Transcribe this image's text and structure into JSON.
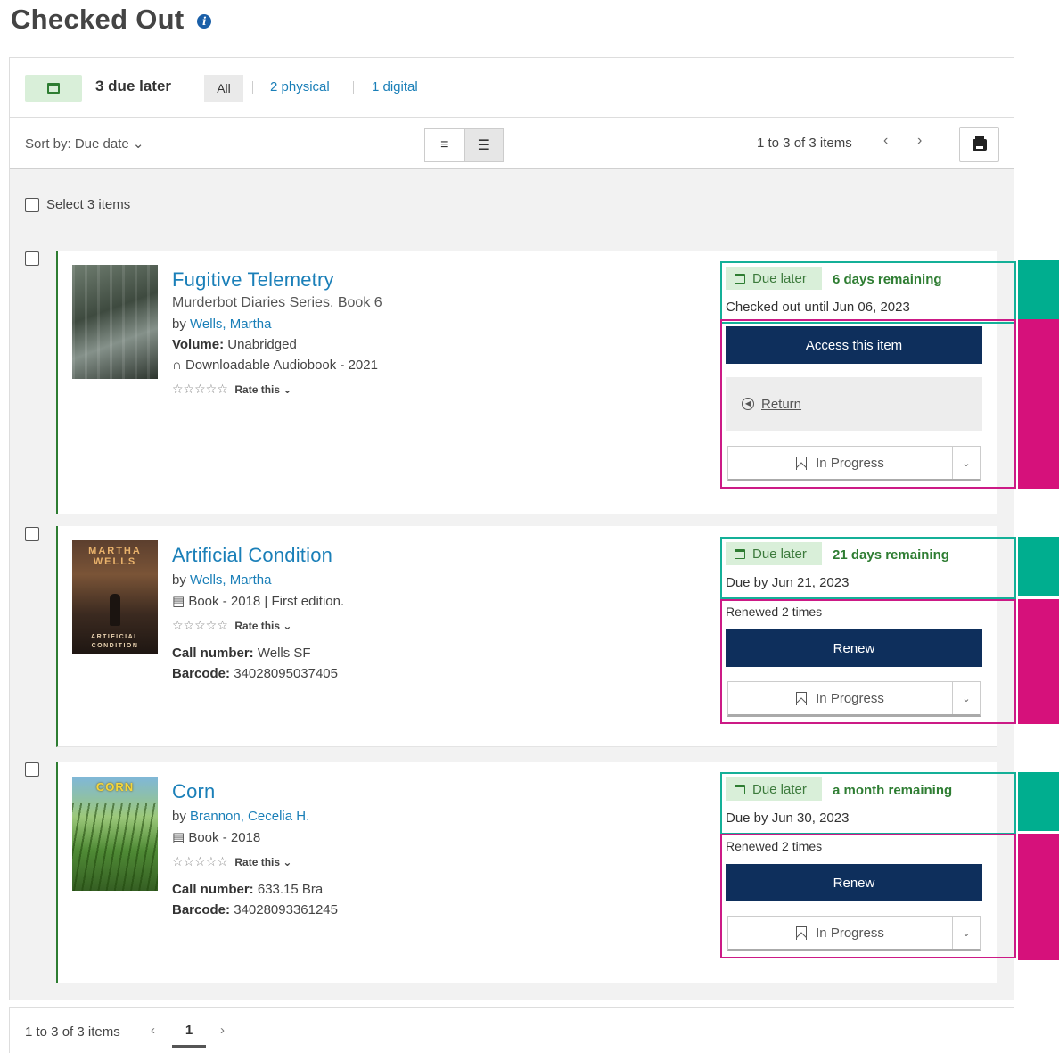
{
  "page": {
    "title": "Checked Out",
    "info_icon": "info-icon"
  },
  "filter": {
    "due_count": "3 due later",
    "all": "All",
    "physical": "2 physical",
    "digital": "1 digital"
  },
  "toolbar": {
    "sort_label": "Sort by: Due date ⌄",
    "range": "1 to 3 of 3 items",
    "prev": "‹",
    "next": "›"
  },
  "select_all": "Select 3 items",
  "items": [
    {
      "title": "Fugitive Telemetry",
      "series": "Murderbot Diaries Series, Book 6",
      "by": "by",
      "author": "Wells, Martha",
      "volume_label": "Volume:",
      "volume_value": "Unabridged",
      "format": "∩ Downloadable Audiobook - 2021",
      "stars": "☆☆☆☆☆",
      "rate": "Rate this ⌄",
      "due_label": "Due later",
      "remaining": "6 days remaining",
      "due_date": "Checked out until Jun 06, 2023",
      "primary": "Access this item",
      "return": "Return",
      "progress": "In Progress"
    },
    {
      "title": "Artificial Condition",
      "by": "by",
      "author": "Wells, Martha",
      "format": "▤ Book - 2018 | First edition.",
      "stars": "☆☆☆☆☆",
      "rate": "Rate this ⌄",
      "call_label": "Call number:",
      "call_value": "Wells SF",
      "barcode_label": "Barcode:",
      "barcode_value": "34028095037405",
      "due_label": "Due later",
      "remaining": "21 days remaining",
      "due_date": "Due by Jun 21, 2023",
      "renewed": "Renewed 2 times",
      "primary": "Renew",
      "progress": "In Progress",
      "cover_top": "MARTHA WELLS",
      "cover_bottom": "ARTIFICIAL CONDITION"
    },
    {
      "title": "Corn",
      "by": "by",
      "author": "Brannon, Cecelia H.",
      "format": "▤ Book - 2018",
      "stars": "☆☆☆☆☆",
      "rate": "Rate this ⌄",
      "call_label": "Call number:",
      "call_value": "633.15 Bra",
      "barcode_label": "Barcode:",
      "barcode_value": "34028093361245",
      "due_label": "Due later",
      "remaining": "a month remaining",
      "due_date": "Due by Jun 30, 2023",
      "renewed": "Renewed 2 times",
      "primary": "Renew",
      "progress": "In Progress",
      "cover_top": "CORN"
    }
  ],
  "bottom": {
    "range": "1 to 3 of 3 items",
    "prev": "‹",
    "page": "1",
    "next": "›"
  },
  "colors": {
    "link": "#1a7fb8",
    "primary_button": "#0e2f5c",
    "due_chip_bg": "#d9efd9",
    "remaining_text": "#2e7d32",
    "status_outline": "#14b098",
    "action_outline": "#cc1a86",
    "teal_marker": "#00ae8f",
    "magenta_marker": "#d6117b"
  }
}
